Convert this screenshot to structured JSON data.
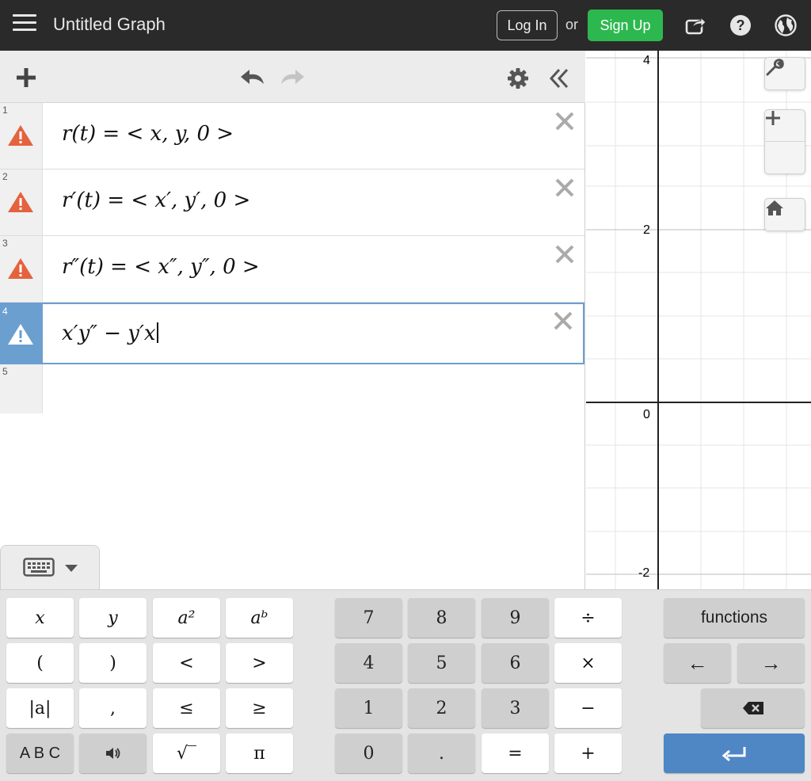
{
  "header": {
    "title": "Untitled Graph",
    "login_label": "Log In",
    "or_label": "or",
    "signup_label": "Sign Up"
  },
  "expressions": [
    {
      "index": "1",
      "latex": "r(t) = < x, y, 0 >",
      "warning": true
    },
    {
      "index": "2",
      "latex": "r′(t) = < x′, y′, 0 >",
      "warning": true
    },
    {
      "index": "3",
      "latex": "r″(t) = < x″, y″, 0 >",
      "warning": true
    },
    {
      "index": "4",
      "latex": "x′y″ − y′x",
      "warning": true,
      "active": true
    },
    {
      "index": "5",
      "latex": ""
    }
  ],
  "graph": {
    "y_ticks": [
      "4",
      "2",
      "0",
      "-2"
    ]
  },
  "keyboard": {
    "left": [
      "x",
      "y",
      "a²",
      "aᵇ",
      "(",
      ")",
      "<",
      ">",
      "|a|",
      ",",
      "≤",
      "≥",
      "A B C",
      "🔈",
      "√‾",
      "π"
    ],
    "numpad": [
      "7",
      "8",
      "9",
      "÷",
      "4",
      "5",
      "6",
      "×",
      "1",
      "2",
      "3",
      "−",
      "0",
      ".",
      "=",
      "+"
    ],
    "functions_label": "functions",
    "left_arrow": "←",
    "right_arrow": "→"
  },
  "colors": {
    "header_bg": "#2a2a2a",
    "signup_green": "#2db84f",
    "warning_orange": "#e4633e",
    "active_blue": "#6b9fd0",
    "enter_blue": "#4f86c4"
  }
}
